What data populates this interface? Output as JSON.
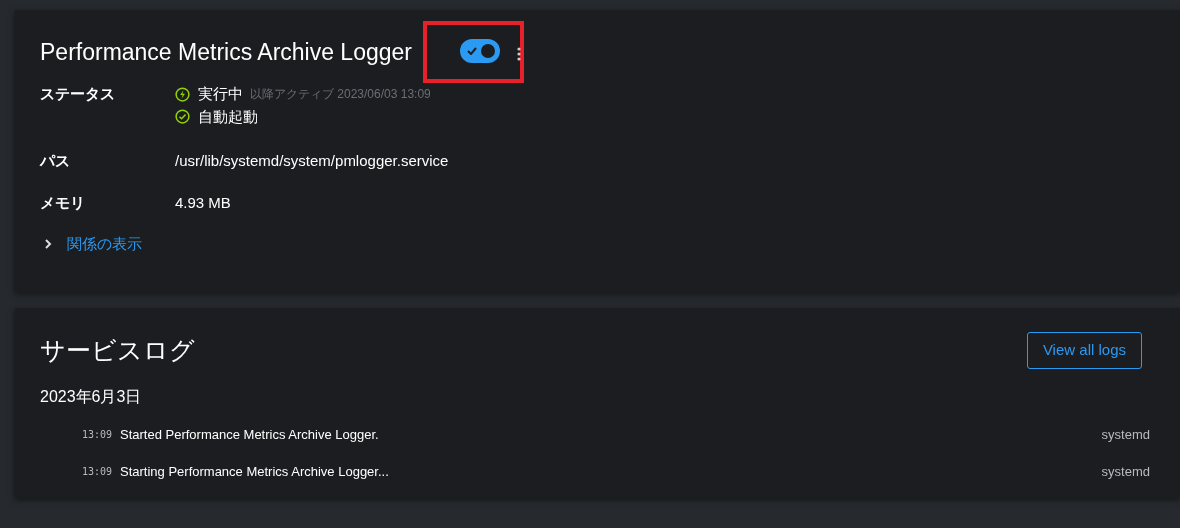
{
  "service": {
    "title": "Performance Metrics Archive Logger",
    "toggle": {
      "on": true,
      "highlighted": true
    },
    "details": [
      {
        "kind": "status",
        "label": "ステータス",
        "lines": [
          {
            "kind": "running",
            "text": "実行中",
            "note": "以降アクティブ 2023/06/03 13:09"
          },
          {
            "kind": "enabled",
            "text": "自動起動"
          }
        ]
      },
      {
        "kind": "text",
        "label": "パス",
        "value": "/usr/lib/systemd/system/pmlogger.service"
      },
      {
        "kind": "text",
        "label": "メモリ",
        "value": "4.93 MB"
      }
    ],
    "relations": {
      "label": "関係の表示",
      "expanded": false
    }
  },
  "logs": {
    "title": "サービスログ",
    "button": "View all logs",
    "date": "2023年6月3日",
    "entries": [
      {
        "time": "13:09",
        "message": "Started Performance Metrics Archive Logger.",
        "source": "systemd"
      },
      {
        "time": "13:09",
        "message": "Starting Performance Metrics Archive Logger...",
        "source": "systemd"
      }
    ]
  }
}
